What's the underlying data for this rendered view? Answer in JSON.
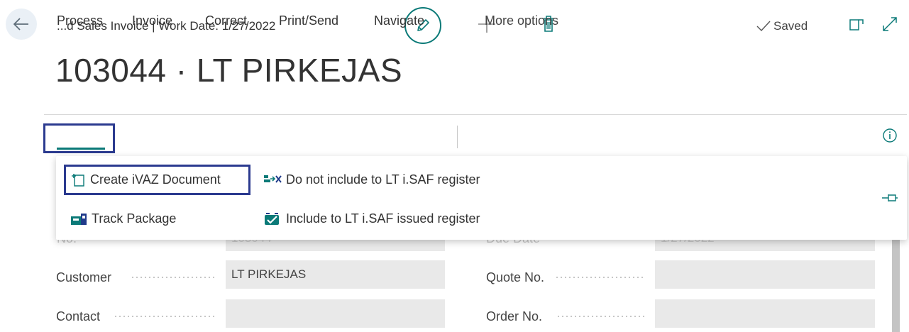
{
  "header": {
    "breadcrumb": "...d Sales Invoice | Work Date: 1/27/2022",
    "saved_label": "Saved",
    "icons": {
      "back": "back-arrow-icon",
      "edit": "pencil-icon",
      "add": "plus-icon",
      "delete": "trash-icon",
      "saved": "checkmark-icon",
      "open_new_window": "open-in-new-window-icon",
      "expand": "expand-icon"
    }
  },
  "page": {
    "title": "103044 · LT PIRKEJAS"
  },
  "action_bar": {
    "items": [
      {
        "label": "Process",
        "selected": true
      },
      {
        "label": "Invoice"
      },
      {
        "label": "Correct"
      },
      {
        "label": "Print/Send"
      },
      {
        "label": "Navigate"
      },
      {
        "label": "More options"
      }
    ],
    "info_icon": "info-icon"
  },
  "process_menu": {
    "items": [
      {
        "label": "Create iVAZ Document",
        "icon": "new-document-icon"
      },
      {
        "label": "Do not include to LT i.SAF register",
        "icon": "exclude-icon"
      },
      {
        "label": "Track Package",
        "icon": "package-icon"
      },
      {
        "label": "Include to LT i.SAF issued register",
        "icon": "include-register-icon"
      }
    ],
    "pin_icon": "pin-icon"
  },
  "form": {
    "no": {
      "label": "No.",
      "value": "103044"
    },
    "due_date": {
      "label": "Due Date",
      "value": "1/27/2022"
    },
    "customer": {
      "label": "Customer",
      "value": "LT PIRKEJAS"
    },
    "quote_no": {
      "label": "Quote No.",
      "value": ""
    },
    "contact": {
      "label": "Contact",
      "value": ""
    },
    "order_no": {
      "label": "Order No.",
      "value": ""
    }
  },
  "colors": {
    "accent": "#0b7a78",
    "highlight_box": "#2b3a8f",
    "field_bg": "#e9e9e9"
  }
}
